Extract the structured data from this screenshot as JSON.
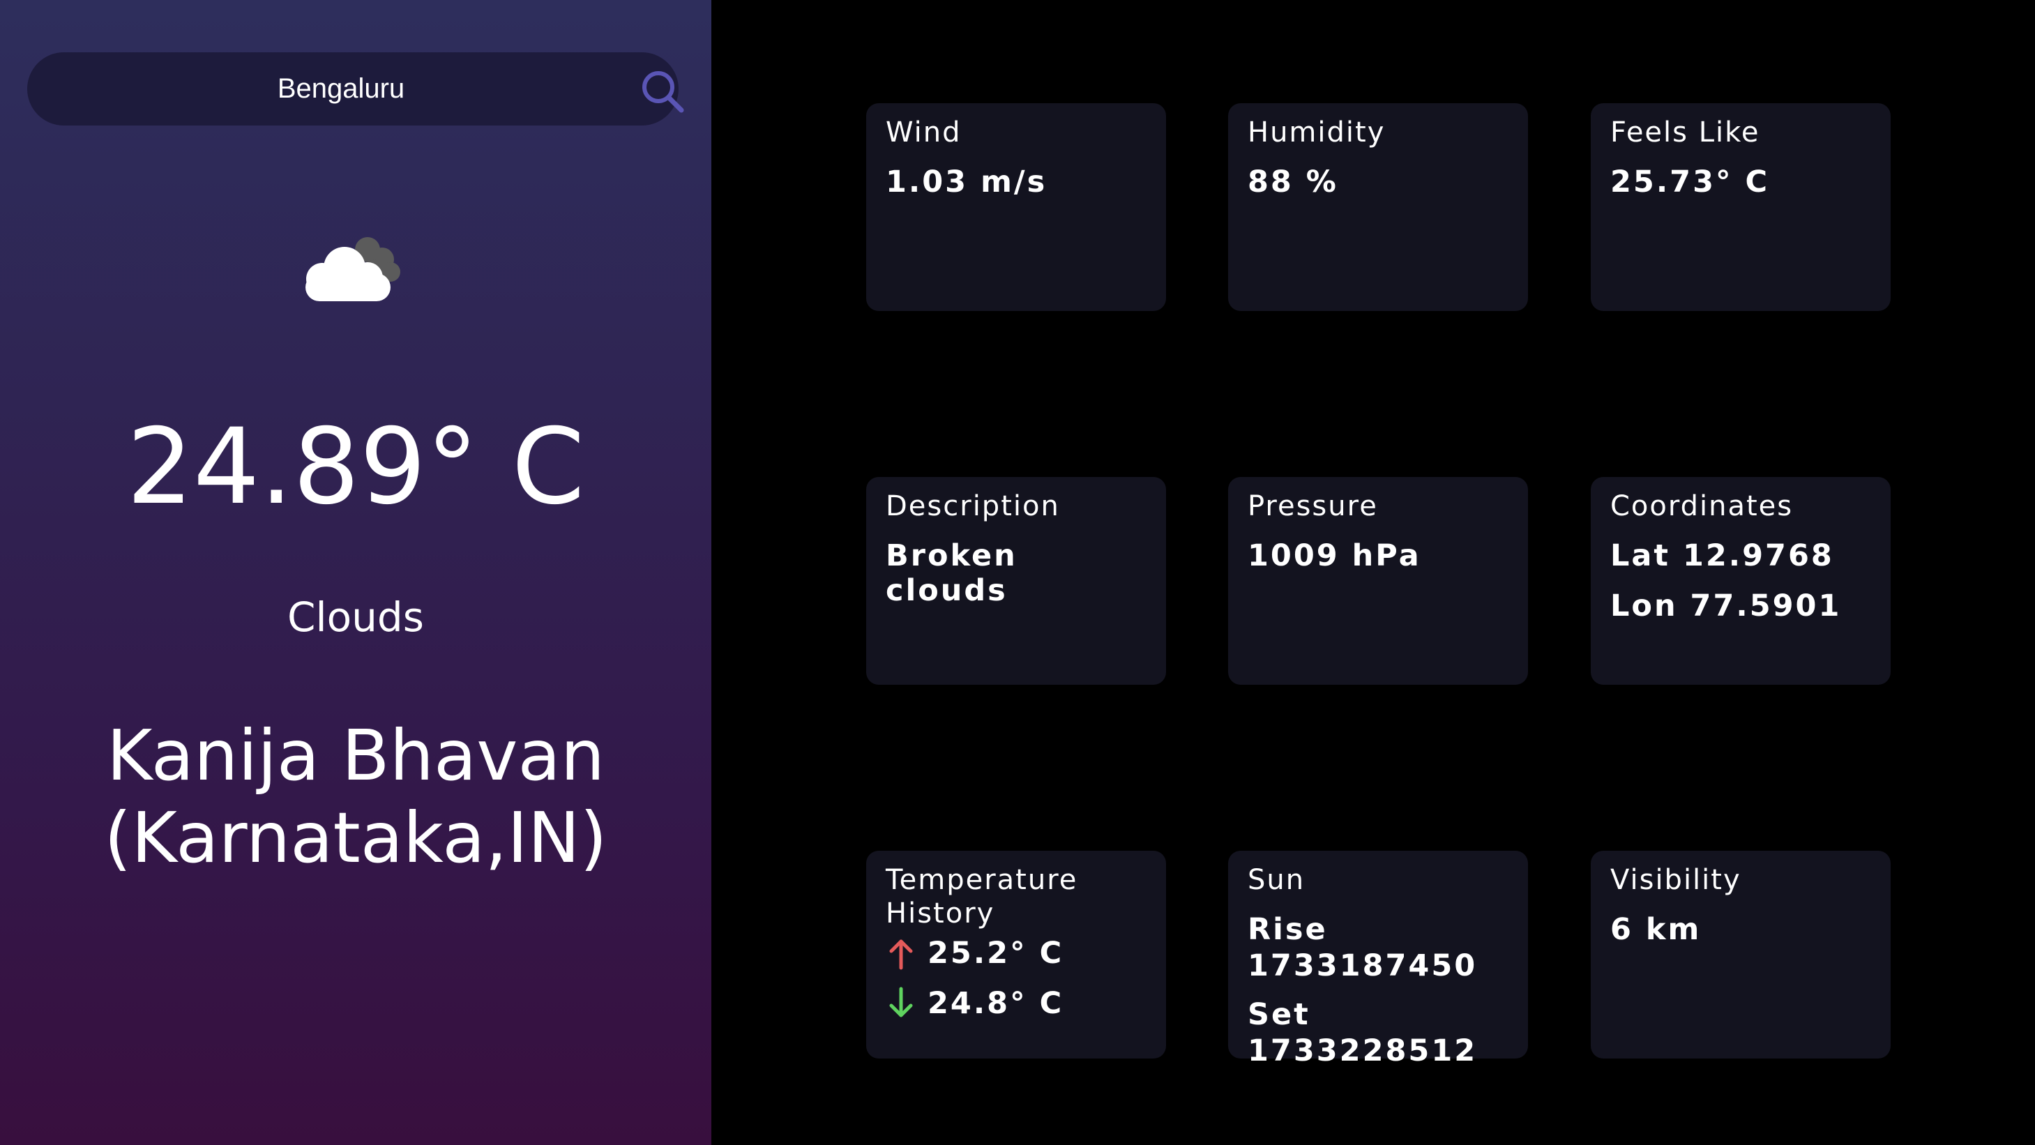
{
  "colors": {
    "panel_gradient_top": "#2e2e5c",
    "panel_gradient_bottom": "#380f3e",
    "card_background": "#13131f",
    "search_icon": "#5a55b5",
    "up_arrow": "#e45a5a",
    "down_arrow": "#5fd35f"
  },
  "search": {
    "value": "Bengaluru",
    "icon": "search-icon"
  },
  "current": {
    "icon": "broken-clouds-icon",
    "temperature": "24.89° C",
    "condition": "Clouds",
    "location": "Kanija Bhavan (Karnataka,IN)"
  },
  "cards": {
    "wind": {
      "title": "Wind",
      "value": "1.03 m/s"
    },
    "humidity": {
      "title": "Humidity",
      "value": "88 %"
    },
    "feels_like": {
      "title": "Feels Like",
      "value": "25.73° C"
    },
    "description": {
      "title": "Description",
      "value": "Broken clouds"
    },
    "pressure": {
      "title": "Pressure",
      "value": "1009 hPa"
    },
    "coordinates": {
      "title": "Coordinates",
      "lat": "Lat 12.9768",
      "lon": "Lon 77.5901"
    },
    "temperature_history": {
      "title_line1": "Temperature",
      "title_line2": "History",
      "max": "25.2° C",
      "min": "24.8° C",
      "max_icon": "arrow-up-icon",
      "min_icon": "arrow-down-icon"
    },
    "sun": {
      "title": "Sun",
      "rise_label": "Rise",
      "rise_value": "1733187450",
      "set_label": "Set",
      "set_value": "1733228512"
    },
    "visibility": {
      "title": "Visibility",
      "value": "6 km"
    }
  }
}
